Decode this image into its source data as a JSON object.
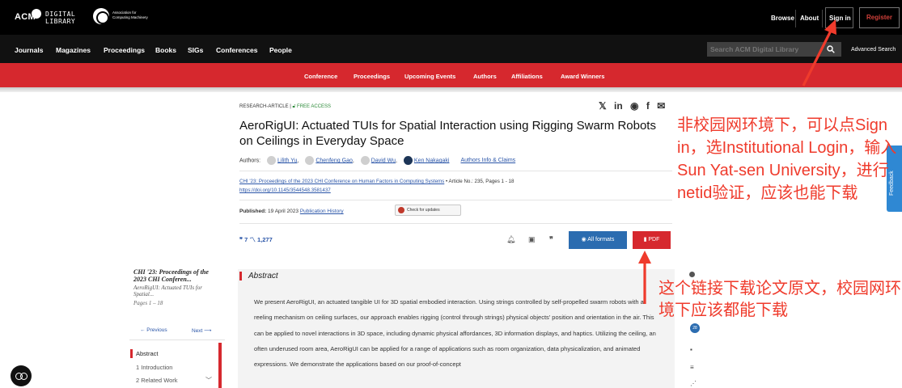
{
  "topbar": {
    "logo_acm": "ACM",
    "logo_digital": "DIGITAL",
    "logo_library": "LIBRARY",
    "assoc_line1": "Association for",
    "assoc_line2": "Computing Machinery",
    "browse": "Browse",
    "about": "About",
    "sign_in": "Sign in",
    "register": "Register"
  },
  "navbar": {
    "items": [
      "Journals",
      "Magazines",
      "Proceedings",
      "Books",
      "SIGs",
      "Conferences",
      "People"
    ],
    "search_placeholder": "Search ACM Digital Library",
    "advanced_search": "Advanced Search"
  },
  "confbar": {
    "items": [
      "Conference",
      "Proceedings",
      "Upcoming Events",
      "Authors",
      "Affiliations",
      "Award Winners"
    ]
  },
  "article": {
    "type": "RESEARCH-ARTICLE",
    "access": "FREE ACCESS",
    "share_icons": [
      "x-icon",
      "linkedin-icon",
      "reddit-icon",
      "facebook-icon",
      "email-icon"
    ],
    "title": "AeroRigUI: Actuated TUIs for Spatial Interaction using Rigging Swarm Robots on Ceilings in Everyday Space",
    "authors_label": "Authors:",
    "authors": [
      "Lilith Yu",
      "Chenfeng Gao",
      "David Wu",
      "Ken Nakagaki"
    ],
    "authors_info": "Authors Info & Claims",
    "proceedings": "CHI '23: Proceedings of the 2023 CHI Conference on Human Factors in Computing Systems",
    "article_meta": "• Article No.: 235, Pages 1 - 18",
    "doi": "https://doi.org/10.1145/3544548.3581437",
    "published_label": "Published:",
    "published_date": "19 April 2023",
    "publication_history": "Publication History",
    "check_updates": "Check for updates",
    "citations": "7",
    "downloads": "1,277",
    "all_formats": "All formats",
    "pdf": "PDF"
  },
  "toc": {
    "conf": "CHI '23: Proceedings of the 2023 CHI Conferen...",
    "article": "AeroRigUI: Actuated TUIs for Spatial...",
    "pages": "Pages 1 – 18",
    "previous": "← Previous",
    "next": "Next ⟶",
    "items": [
      "Abstract",
      "1 Introduction",
      "2 Related Work"
    ]
  },
  "abstract": {
    "heading": "Abstract",
    "text": "We present AeroRigUI, an actuated tangible UI for 3D spatial embodied interaction. Using strings controlled by self-propelled swarm robots with a reeling mechanism on ceiling surfaces, our approach enables rigging (control through strings) physical objects' position and orientation in the air. This can be applied to novel interactions in 3D space, including dynamic physical affordances, 3D information displays, and haptics. Utilizing the ceiling, an often underused room area, AeroRigUI can be applied for a range of applications such as room organization, data physicalization, and animated expressions. We demonstrate the applications based on our proof-of-concept"
  },
  "rail": {
    "badge": "28"
  },
  "feedback": "Feedback",
  "annotations": {
    "note1": "非校园网环境下，可以点Sign in，选Institutional Login，输入Sun Yat-sen University，进行netid验证，应该也能下载",
    "note2": "这个链接下载论文原文，校园网环境下应该都能下载",
    "color": "#ef3b2c"
  },
  "colors": {
    "acm_red": "#d6282e",
    "link_blue": "#2a55a8",
    "button_blue": "#2b6cb0",
    "feedback_blue": "#2f88d3"
  }
}
